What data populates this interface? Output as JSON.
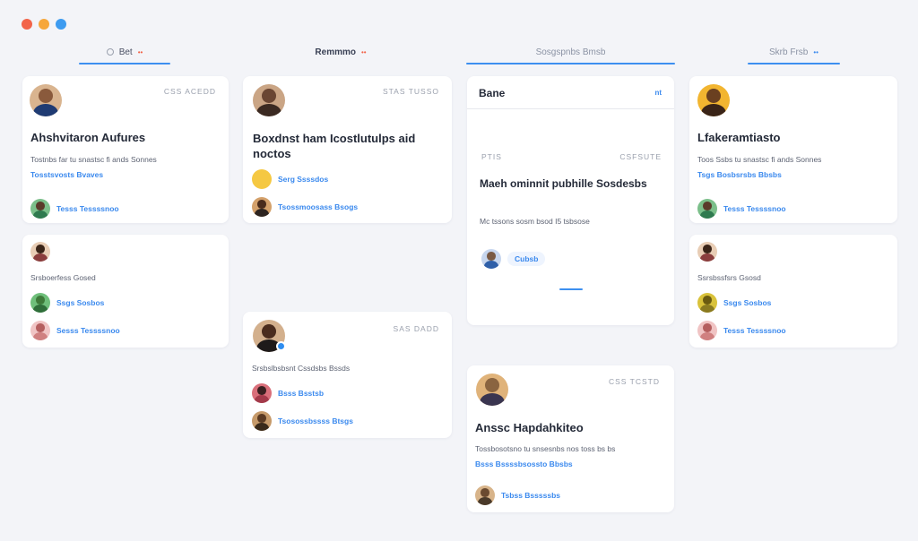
{
  "colors": {
    "dot_red": "#f2644a",
    "dot_orange": "#f6a73b",
    "dot_blue": "#3d9bf0",
    "accent": "#3d8ff0"
  },
  "columns": [
    {
      "label": "Bet",
      "icon": "circle-icon",
      "badge": "••"
    },
    {
      "label": "Remmmo",
      "badge": "••"
    },
    {
      "label": "Sosgspnbs Bmsb",
      "badge": ""
    },
    {
      "label": "Skrb Frsb",
      "badge": "••"
    }
  ],
  "cards": {
    "c1": {
      "meta": "CSS ACEDD",
      "title": "Ahshvitaron Aufures",
      "desc": "Tostnbs far tu snastsc fi ands Sonnes",
      "link": "Tosstsvosts Bvaves",
      "person": "Tesss Tessssnoo"
    },
    "c2": {
      "desc": "Srsboerfess Gosed",
      "person1": "Ssgs Sosbos",
      "person2": "Sesss Tessssnoo"
    },
    "c3": {
      "meta": "STAS TUSSO",
      "title": "Boxdnst ham Icostlutulps aid noctos",
      "person1": "Serg Ssssdos",
      "person2": "Tsossmoosass Bsogs"
    },
    "c4": {
      "title": "Bane",
      "count": "nt",
      "meta_left": "PTIS",
      "meta_right": "CSFSUTE",
      "title2": "Maeh ominnit pubhille Sosdesbs",
      "desc": "Mc tssons sosm bsod I5 tsbsose",
      "chip": "Cubsb"
    },
    "c5": {
      "meta": "SAS DADD",
      "desc": "Srsbslbsbsnt Cssdsbs Bssds",
      "person1": "Bsss Bsstsb",
      "person2": "Tsosossbssss Btsgs"
    },
    "c6": {
      "meta": "CSS TCSTD",
      "title": "Anssc Hapdahkiteo",
      "desc": "Tossbosotsno tu snsesnbs nos toss bs bs",
      "link": "Bsss Bssssbsossto Bbsbs",
      "person": "Tsbss Bsssssbs"
    },
    "c7": {
      "title": "Lfakeramtiasto",
      "desc": "Toos Ssbs tu snastsc fi ands Sonnes",
      "link": "Tsgs Bosbsrsbs Bbsbs",
      "person": "Tesss Tessssnoo"
    },
    "c8": {
      "desc": "Ssrsbssfsrs Gsosd",
      "person1": "Ssgs Sosbos",
      "person2": "Tesss Tessssnoo"
    }
  }
}
